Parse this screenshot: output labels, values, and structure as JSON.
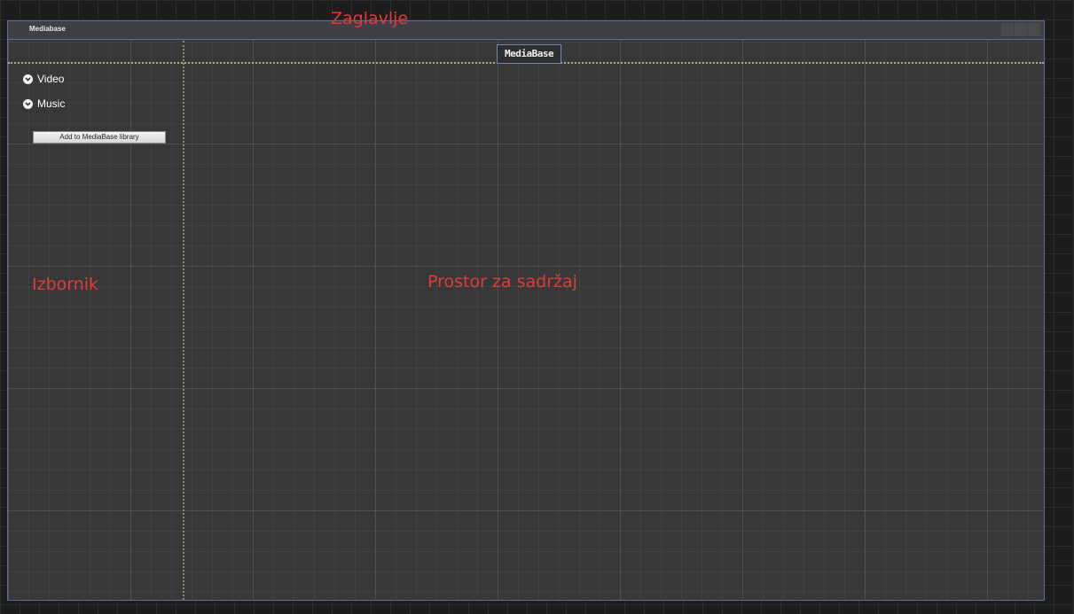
{
  "window": {
    "title": "Mediabase"
  },
  "header": {
    "app_title": "MediaBase",
    "annotation": "Zaglavlje"
  },
  "sidebar": {
    "annotation": "Izbornik",
    "items": [
      {
        "label": "Video",
        "icon": "chevron-down-icon"
      },
      {
        "label": "Music",
        "icon": "chevron-down-icon"
      }
    ],
    "add_button_label": "Add to MediaBase library"
  },
  "content": {
    "annotation": "Prostor za sadržaj"
  },
  "colors": {
    "window_background": "#383838",
    "window_border": "#5c6f99",
    "annotation_red": "#e23a3a",
    "divider": "#b5ac7a"
  }
}
